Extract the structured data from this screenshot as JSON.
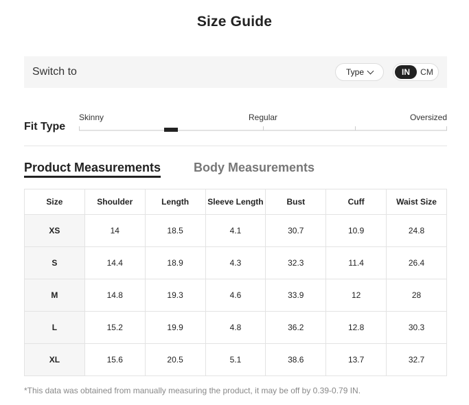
{
  "title": "Size Guide",
  "switch_bar": {
    "label": "Switch to",
    "type_button": "Type",
    "units": [
      "IN",
      "CM"
    ],
    "selected_unit": "IN"
  },
  "fit_type": {
    "label": "Fit Type",
    "options": [
      "Skinny",
      "Regular",
      "Oversized"
    ]
  },
  "tabs": [
    {
      "label": "Product Measurements",
      "active": true
    },
    {
      "label": "Body Measurements",
      "active": false
    }
  ],
  "table": {
    "headers": [
      "Size",
      "Shoulder",
      "Length",
      "Sleeve Length",
      "Bust",
      "Cuff",
      "Waist Size"
    ],
    "rows": [
      [
        "XS",
        "14",
        "18.5",
        "4.1",
        "30.7",
        "10.9",
        "24.8"
      ],
      [
        "S",
        "14.4",
        "18.9",
        "4.3",
        "32.3",
        "11.4",
        "26.4"
      ],
      [
        "M",
        "14.8",
        "19.3",
        "4.6",
        "33.9",
        "12",
        "28"
      ],
      [
        "L",
        "15.2",
        "19.9",
        "4.8",
        "36.2",
        "12.8",
        "30.3"
      ],
      [
        "XL",
        "15.6",
        "20.5",
        "5.1",
        "38.6",
        "13.7",
        "32.7"
      ]
    ]
  },
  "footnote": "*This data was obtained from manually measuring the product, it may be off by 0.39-0.79 IN."
}
